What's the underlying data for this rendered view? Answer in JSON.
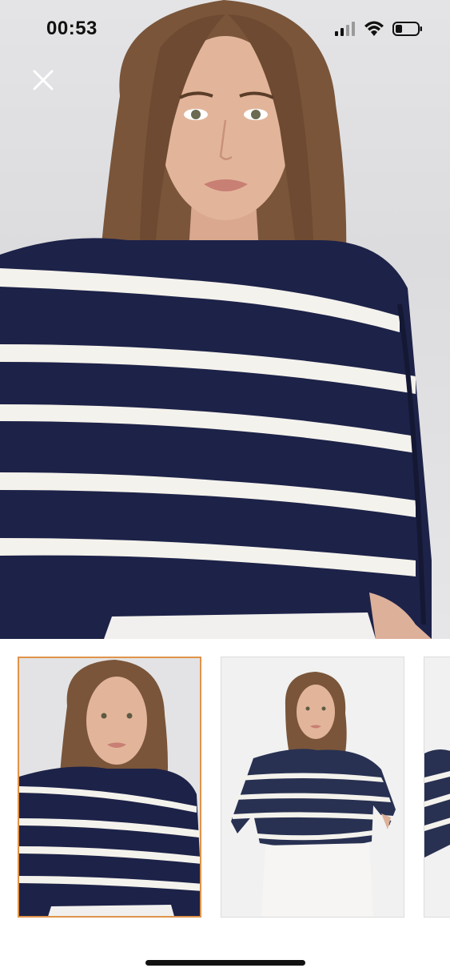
{
  "status_bar": {
    "time": "00:53",
    "signal_icon": "cellular-signal-icon",
    "wifi_icon": "wifi-icon",
    "battery_icon": "battery-low-icon",
    "battery_level": 0.25
  },
  "viewer": {
    "close_icon": "close-icon",
    "main_image": "product-photo-striped-sweater-front"
  },
  "thumbnails": [
    {
      "image": "product-photo-front",
      "selected": true
    },
    {
      "image": "product-photo-full-body",
      "selected": false
    },
    {
      "image": "product-photo-side",
      "selected": false
    }
  ],
  "colors": {
    "navy": "#1d2248",
    "stripe": "#f4f2ec",
    "selected_border": "#e0934a",
    "hair": "#7a553a",
    "skin": "#e2b59a"
  }
}
